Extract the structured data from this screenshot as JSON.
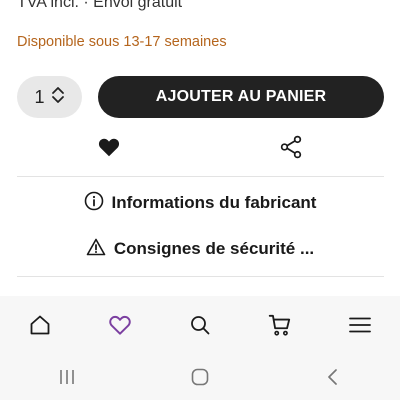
{
  "product": {
    "vat_text": "TVA incl. · Envoi gratuit",
    "availability": "Disponible sous 13-17 semaines",
    "availability_color": "#b5651d"
  },
  "cart": {
    "quantity": "1",
    "add_to_cart_label": "AJOUTER AU PANIER",
    "button_color": "#222222"
  },
  "actions": {
    "wishlist_icon": "heart-filled-icon",
    "share_icon": "share-icon"
  },
  "info_links": [
    {
      "label": "Informations du fabricant",
      "icon": "info-circle-icon"
    },
    {
      "label": "Consignes de sécurité ...",
      "icon": "warning-triangle-icon"
    }
  ],
  "bottom_nav": {
    "items": [
      {
        "name": "home",
        "icon": "home-icon"
      },
      {
        "name": "wishlist",
        "icon": "heart-outline-icon",
        "color": "#7b3fa0"
      },
      {
        "name": "search",
        "icon": "search-icon"
      },
      {
        "name": "cart",
        "icon": "cart-icon"
      },
      {
        "name": "menu",
        "icon": "menu-icon"
      }
    ]
  },
  "system_nav": {
    "items": [
      {
        "name": "recents",
        "icon": "recents-icon"
      },
      {
        "name": "home",
        "icon": "home-pill-icon"
      },
      {
        "name": "back",
        "icon": "back-icon"
      }
    ]
  }
}
